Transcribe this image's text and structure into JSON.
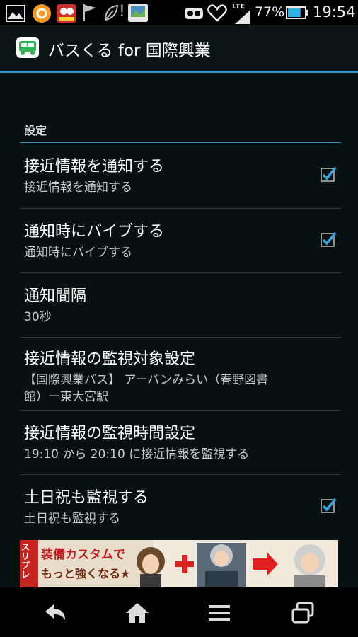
{
  "status_bar": {
    "notification_icons": [
      "image-icon",
      "orange-circle-icon",
      "game-icon",
      "flag-icon",
      "leaf-icon",
      "exclamation-icon",
      "photo-icon"
    ],
    "system_icons": [
      "headset-icon",
      "heart-icon",
      "lte-signal-icon",
      "battery-icon"
    ],
    "network_label": "LTE",
    "battery": "77%",
    "battery_level": 0.77,
    "time": "19:54"
  },
  "action_bar": {
    "title": "バスくる for 国際興業",
    "app_icon": "bus-icon"
  },
  "settings": {
    "section_header": "設定",
    "items": [
      {
        "title": "接近情報を通知する",
        "summary": "接近情報を通知する",
        "checked": true
      },
      {
        "title": "通知時にバイブする",
        "summary": "通知時にバイブする",
        "checked": true
      },
      {
        "title": "通知間隔",
        "summary": "30秒"
      },
      {
        "title": "接近情報の監視対象設定",
        "summary_line1": "【国際興業バス】 アーバンみらい（春野図書",
        "summary_line2": "館）ー東大宮駅"
      },
      {
        "title": "接近情報の監視時間設定",
        "summary": "19:10 から 20:10 に接近情報を監視する"
      },
      {
        "title": "土日祝も監視する",
        "summary": "土日祝も監視する",
        "checked": true
      }
    ]
  },
  "ad": {
    "side_label": "スリプレ",
    "line1": "装備カスタムで",
    "line2": "もっと強くなる★"
  },
  "nav_bar": {
    "buttons": [
      "back-icon",
      "home-icon",
      "menu-icon",
      "recent-apps-icon"
    ]
  },
  "colors": {
    "accent": "#2f93c7",
    "background": "#081111",
    "checkbox_check": "#35a6e0"
  }
}
